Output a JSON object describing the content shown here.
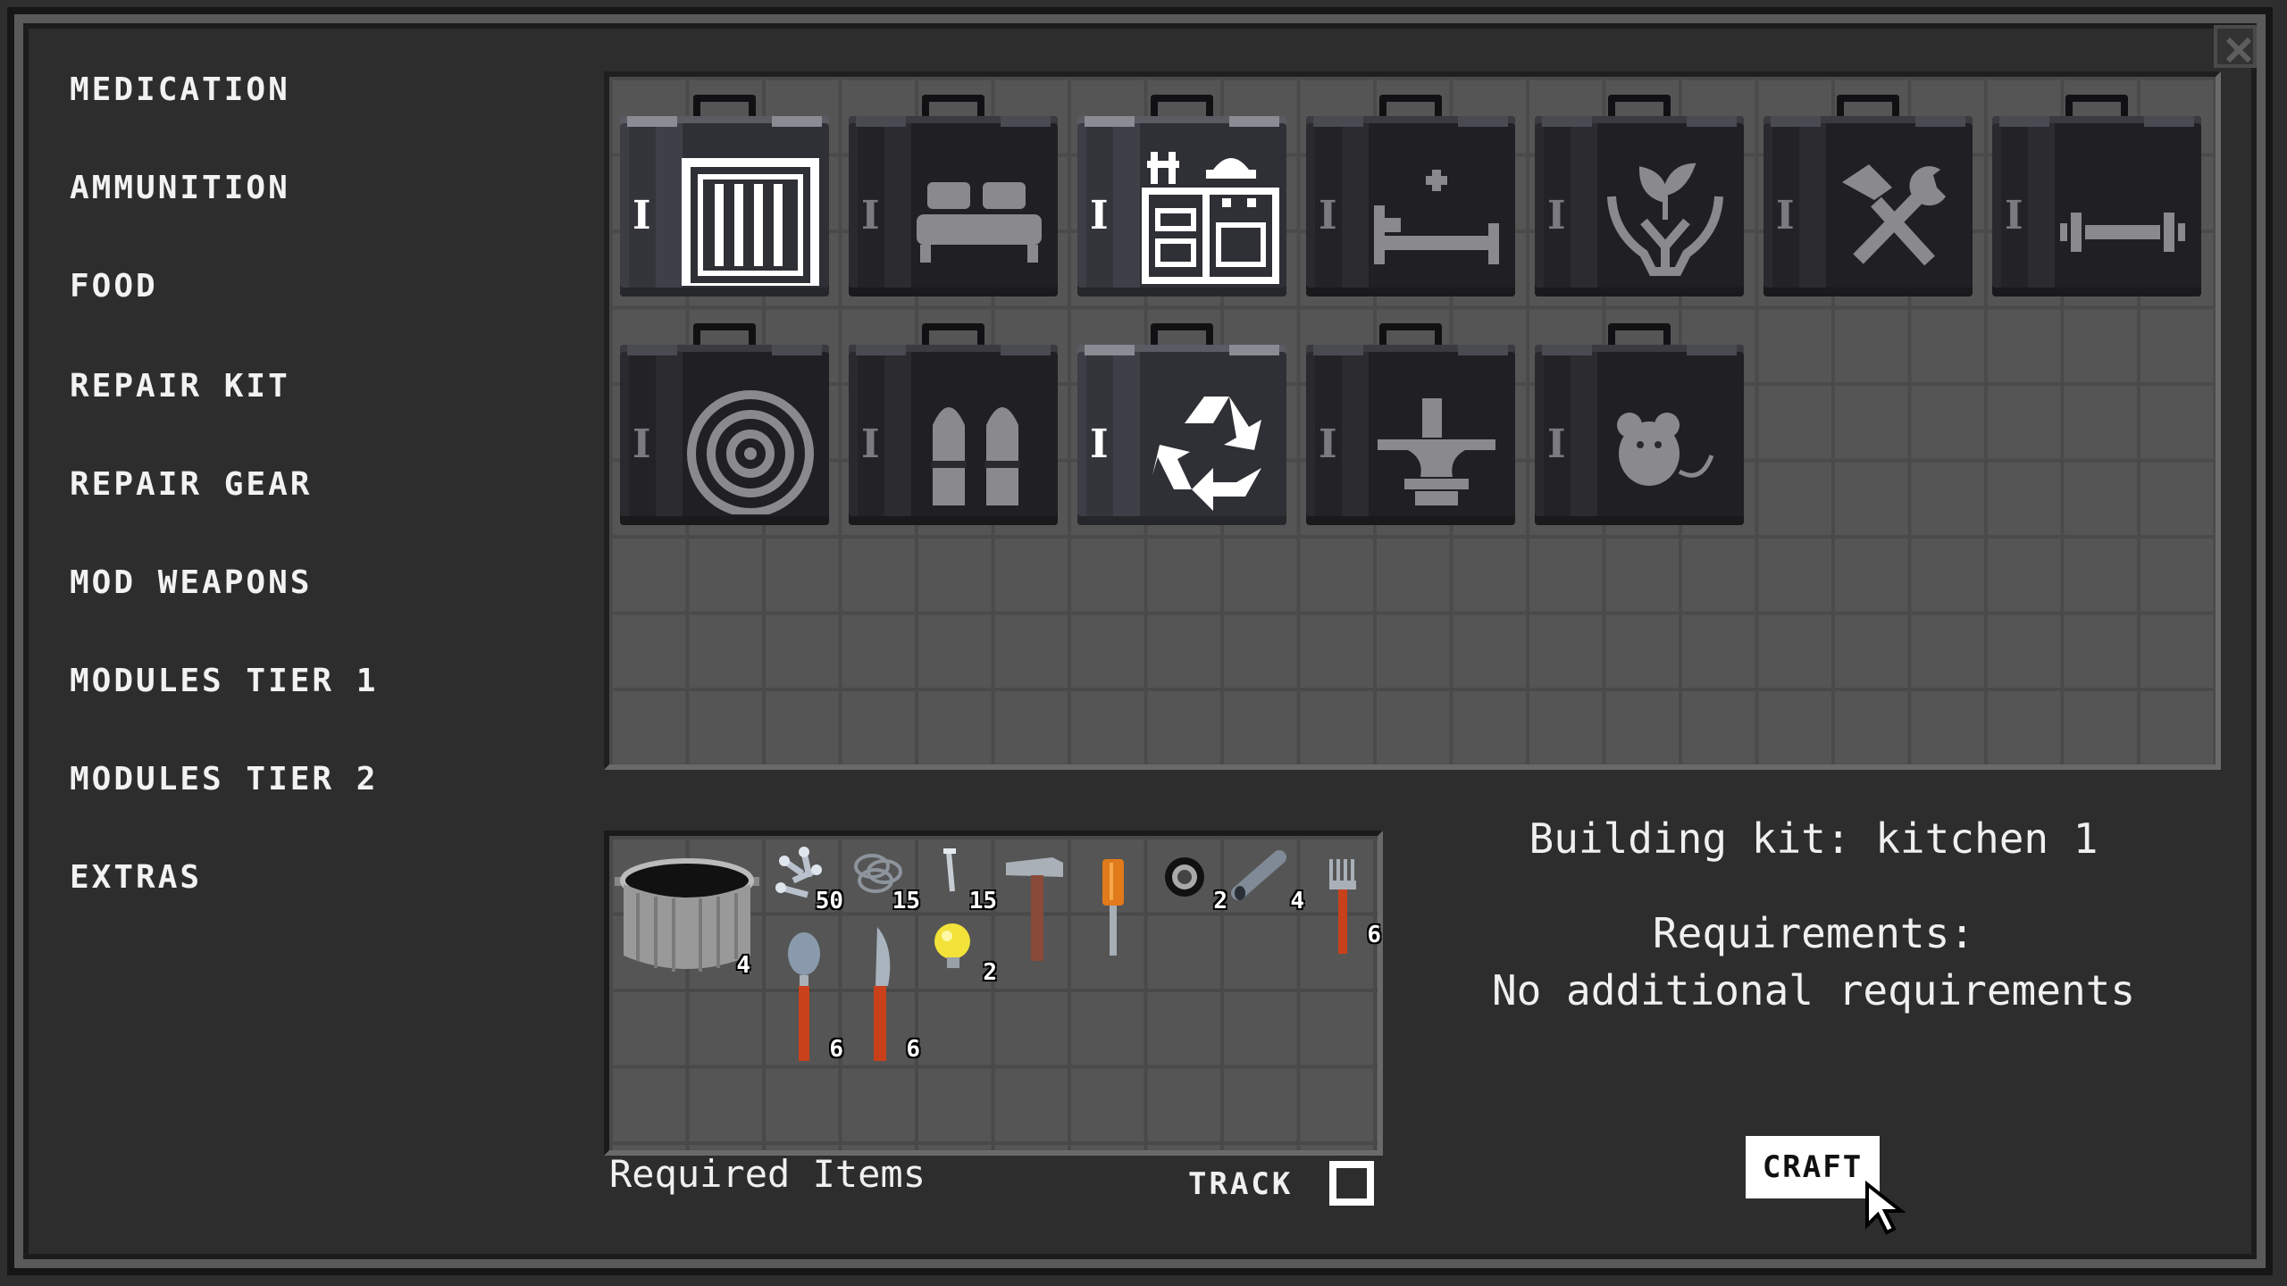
{
  "categories": [
    "MEDICATION",
    "AMMUNITION",
    "FOOD",
    "REPAIR KIT",
    "REPAIR GEAR",
    "MOD WEAPONS",
    "MODULES TIER 1",
    "MODULES TIER 2",
    "EXTRAS"
  ],
  "recipes": [
    {
      "tier": "I",
      "icon": "prison-bars-icon",
      "selected": false,
      "highlight": true
    },
    {
      "tier": "I",
      "icon": "bed-icon",
      "selected": false,
      "highlight": false
    },
    {
      "tier": "I",
      "icon": "kitchen-icon",
      "selected": true,
      "highlight": true
    },
    {
      "tier": "I",
      "icon": "medical-bed-icon",
      "selected": false,
      "highlight": false
    },
    {
      "tier": "I",
      "icon": "plant-hands-icon",
      "selected": false,
      "highlight": false
    },
    {
      "tier": "I",
      "icon": "hammer-wrench-icon",
      "selected": false,
      "highlight": false
    },
    {
      "tier": "I",
      "icon": "dumbbell-icon",
      "selected": false,
      "highlight": false
    },
    {
      "tier": "I",
      "icon": "target-icon",
      "selected": false,
      "highlight": false
    },
    {
      "tier": "I",
      "icon": "bullets-icon",
      "selected": false,
      "highlight": false
    },
    {
      "tier": "I",
      "icon": "recycle-icon",
      "selected": false,
      "highlight": true
    },
    {
      "tier": "I",
      "icon": "anvil-icon",
      "selected": false,
      "highlight": false
    },
    {
      "tier": "I",
      "icon": "mouse-icon",
      "selected": false,
      "highlight": false
    }
  ],
  "required_items": [
    {
      "icon": "cooking-pot-icon",
      "qty": "4"
    },
    {
      "icon": "screws-icon",
      "qty": "50"
    },
    {
      "icon": "wire-icon",
      "qty": "15"
    },
    {
      "icon": "nails-icon",
      "qty": "15"
    },
    {
      "icon": "hammer-icon",
      "qty": ""
    },
    {
      "icon": "screwdriver-icon",
      "qty": ""
    },
    {
      "icon": "duct-tape-icon",
      "qty": "2"
    },
    {
      "icon": "metal-pipe-icon",
      "qty": "4"
    },
    {
      "icon": "fork-icon",
      "qty": "6"
    },
    {
      "icon": "spoon-icon",
      "qty": "6"
    },
    {
      "icon": "knife-icon",
      "qty": "6"
    },
    {
      "icon": "light-bulb-icon",
      "qty": "2"
    }
  ],
  "required_label": "Required Items",
  "track_label": "TRACK",
  "track_checked": false,
  "info": {
    "title": "Building kit: kitchen 1",
    "requirements_label": "Requirements:",
    "requirements_value": "No additional requirements"
  },
  "craft_label": "CRAFT",
  "colors": {
    "background": "#2d2d2d",
    "slot": "#555555",
    "orange_handle": "#c8411a"
  }
}
